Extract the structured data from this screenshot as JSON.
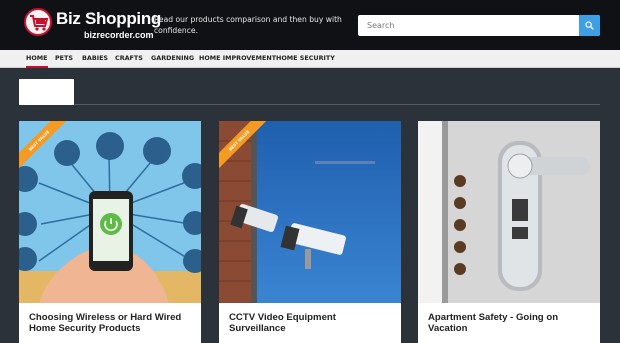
{
  "header": {
    "logo_title": "Biz Shopping",
    "logo_sub": "bizrecorder.com",
    "tagline": "Read our products comparison and then buy with confidence.",
    "search_placeholder": "Search"
  },
  "nav": {
    "items": [
      {
        "label": "HOME"
      },
      {
        "label": "PETS"
      },
      {
        "label": "BABIES"
      },
      {
        "label": "CRAFTS"
      },
      {
        "label": "GARDENING"
      },
      {
        "label": "HOME IMPROVEMENT"
      },
      {
        "label": "HOME SECURITY"
      }
    ]
  },
  "cards": [
    {
      "title": "Choosing Wireless or Hard Wired Home Security Products",
      "badge": "BEST VALUE"
    },
    {
      "title": "CCTV Video Equipment Surveillance",
      "badge": "BEST VALUE"
    },
    {
      "title": "Apartment Safety - Going on Vacation"
    }
  ],
  "colors": {
    "topbar": "#0f1114",
    "page_bg": "#2c323a",
    "accent": "#c8102e",
    "search_button": "#3e9fe4",
    "badge": "#f59a23"
  }
}
